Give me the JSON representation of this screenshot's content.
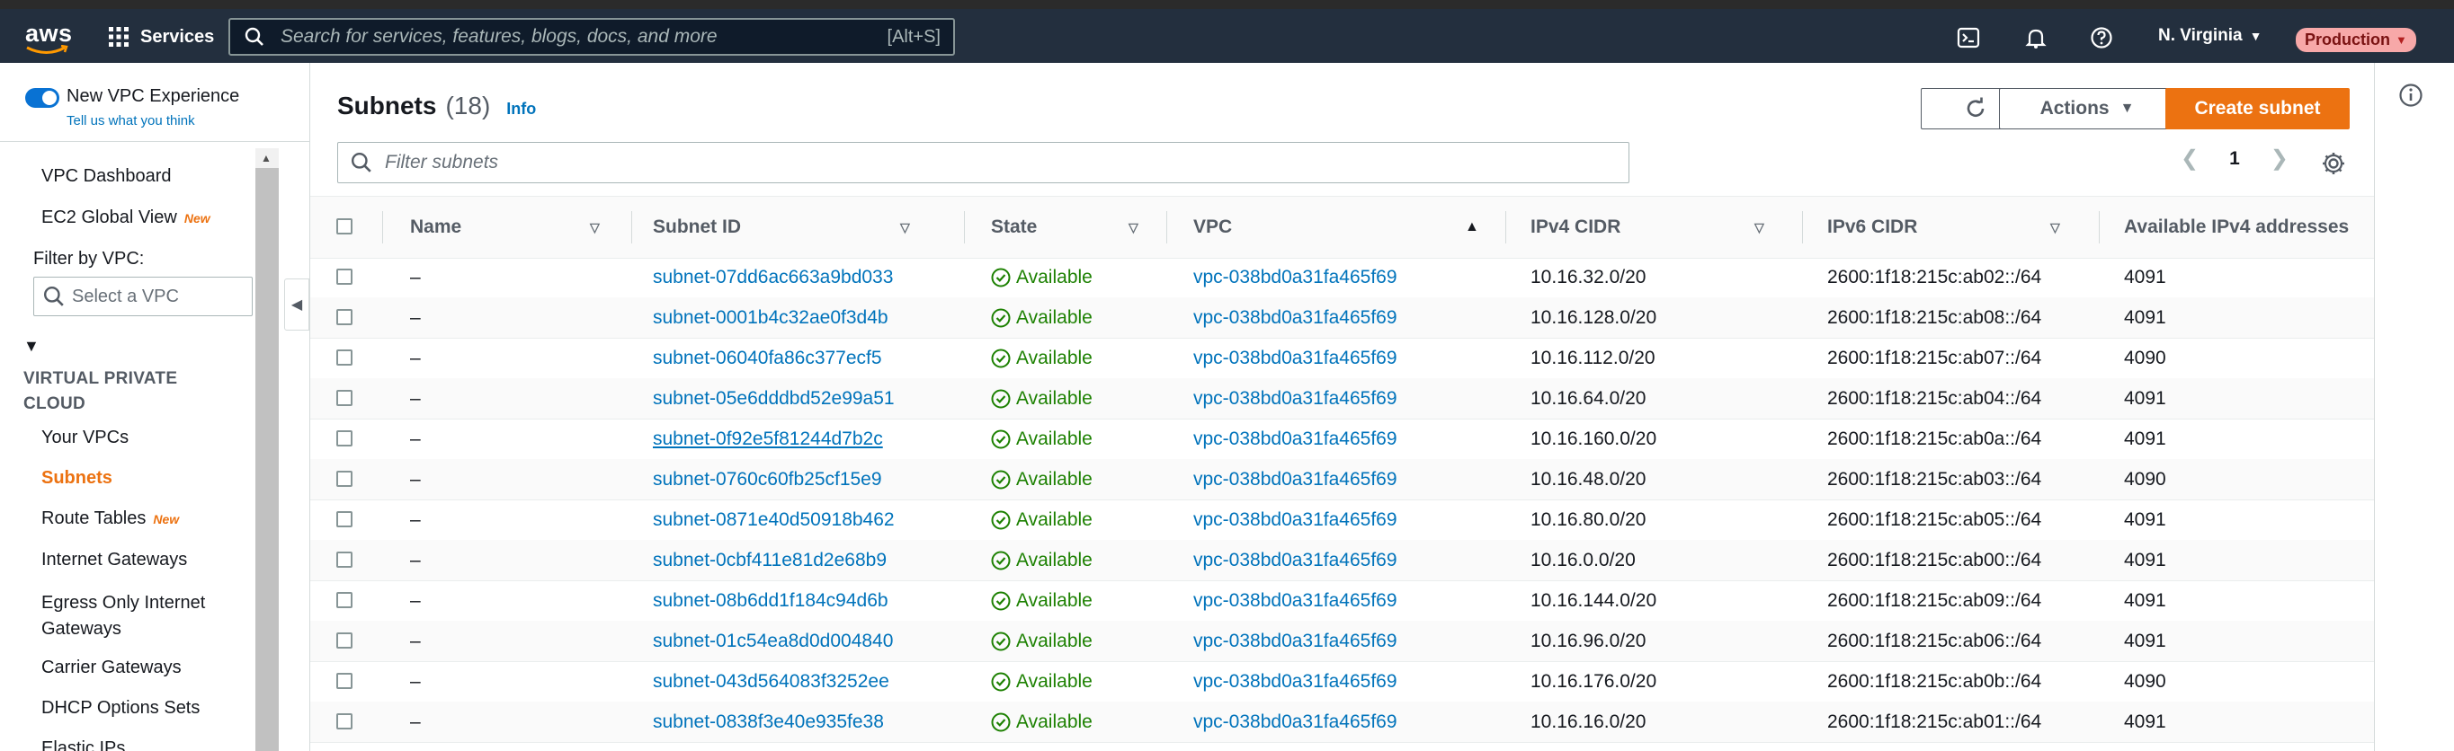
{
  "topnav": {
    "logo_text": "aws",
    "services_label": "Services",
    "search_placeholder": "Search for services, features, blogs, docs, and more",
    "search_shortcut": "[Alt+S]",
    "region": "N. Virginia",
    "environment": "Production",
    "icons": [
      "cloudshell-icon",
      "notifications-icon",
      "help-icon"
    ]
  },
  "sidebar": {
    "experience_label": "New VPC Experience",
    "experience_link": "Tell us what you think",
    "items_top": [
      {
        "label": "VPC Dashboard",
        "badge": ""
      },
      {
        "label": "EC2 Global View",
        "badge": "New"
      }
    ],
    "filter_label": "Filter by VPC:",
    "filter_placeholder": "Select a VPC",
    "section_title": "VIRTUAL PRIVATE CLOUD",
    "items": [
      {
        "label": "Your VPCs",
        "badge": ""
      },
      {
        "label": "Subnets",
        "badge": "",
        "active": true
      },
      {
        "label": "Route Tables",
        "badge": "New"
      },
      {
        "label": "Internet Gateways",
        "badge": ""
      },
      {
        "label": "Egress Only Internet Gateways",
        "badge": ""
      },
      {
        "label": "Carrier Gateways",
        "badge": ""
      },
      {
        "label": "DHCP Options Sets",
        "badge": ""
      },
      {
        "label": "Elastic IPs",
        "badge": ""
      }
    ]
  },
  "main": {
    "title": "Subnets",
    "count": "(18)",
    "info": "Info",
    "actions_label": "Actions",
    "create_label": "Create subnet",
    "filter_placeholder": "Filter subnets",
    "page": "1",
    "columns": [
      "Name",
      "Subnet ID",
      "State",
      "VPC",
      "IPv4 CIDR",
      "IPv6 CIDR",
      "Available IPv4 addresses"
    ],
    "sorted_column": "VPC",
    "rows": [
      {
        "name": "–",
        "subnet_id": "subnet-07dd6ac663a9bd033",
        "state": "Available",
        "vpc": "vpc-038bd0a31fa465f69",
        "ipv4": "10.16.32.0/20",
        "ipv6": "2600:1f18:215c:ab02::/64",
        "avail": "4091"
      },
      {
        "name": "–",
        "subnet_id": "subnet-0001b4c32ae0f3d4b",
        "state": "Available",
        "vpc": "vpc-038bd0a31fa465f69",
        "ipv4": "10.16.128.0/20",
        "ipv6": "2600:1f18:215c:ab08::/64",
        "avail": "4091"
      },
      {
        "name": "–",
        "subnet_id": "subnet-06040fa86c377ecf5",
        "state": "Available",
        "vpc": "vpc-038bd0a31fa465f69",
        "ipv4": "10.16.112.0/20",
        "ipv6": "2600:1f18:215c:ab07::/64",
        "avail": "4090"
      },
      {
        "name": "–",
        "subnet_id": "subnet-05e6dddbd52e99a51",
        "state": "Available",
        "vpc": "vpc-038bd0a31fa465f69",
        "ipv4": "10.16.64.0/20",
        "ipv6": "2600:1f18:215c:ab04::/64",
        "avail": "4091"
      },
      {
        "name": "–",
        "subnet_id": "subnet-0f92e5f81244d7b2c",
        "state": "Available",
        "vpc": "vpc-038bd0a31fa465f69",
        "ipv4": "10.16.160.0/20",
        "ipv6": "2600:1f18:215c:ab0a::/64",
        "avail": "4091"
      },
      {
        "name": "–",
        "subnet_id": "subnet-0760c60fb25cf15e9",
        "state": "Available",
        "vpc": "vpc-038bd0a31fa465f69",
        "ipv4": "10.16.48.0/20",
        "ipv6": "2600:1f18:215c:ab03::/64",
        "avail": "4090"
      },
      {
        "name": "–",
        "subnet_id": "subnet-0871e40d50918b462",
        "state": "Available",
        "vpc": "vpc-038bd0a31fa465f69",
        "ipv4": "10.16.80.0/20",
        "ipv6": "2600:1f18:215c:ab05::/64",
        "avail": "4091"
      },
      {
        "name": "–",
        "subnet_id": "subnet-0cbf411e81d2e68b9",
        "state": "Available",
        "vpc": "vpc-038bd0a31fa465f69",
        "ipv4": "10.16.0.0/20",
        "ipv6": "2600:1f18:215c:ab00::/64",
        "avail": "4091"
      },
      {
        "name": "–",
        "subnet_id": "subnet-08b6dd1f184c94d6b",
        "state": "Available",
        "vpc": "vpc-038bd0a31fa465f69",
        "ipv4": "10.16.144.0/20",
        "ipv6": "2600:1f18:215c:ab09::/64",
        "avail": "4091"
      },
      {
        "name": "–",
        "subnet_id": "subnet-01c54ea8d0d004840",
        "state": "Available",
        "vpc": "vpc-038bd0a31fa465f69",
        "ipv4": "10.16.96.0/20",
        "ipv6": "2600:1f18:215c:ab06::/64",
        "avail": "4091"
      },
      {
        "name": "–",
        "subnet_id": "subnet-043d564083f3252ee",
        "state": "Available",
        "vpc": "vpc-038bd0a31fa465f69",
        "ipv4": "10.16.176.0/20",
        "ipv6": "2600:1f18:215c:ab0b::/64",
        "avail": "4090"
      },
      {
        "name": "–",
        "subnet_id": "subnet-0838f3e40e935fe38",
        "state": "Available",
        "vpc": "vpc-038bd0a31fa465f69",
        "ipv4": "10.16.16.0/20",
        "ipv6": "2600:1f18:215c:ab01::/64",
        "avail": "4091"
      }
    ]
  },
  "colors": {
    "nav_bg": "#232f3e",
    "accent": "#ec7211",
    "link": "#0073bb",
    "success": "#1d8102"
  }
}
